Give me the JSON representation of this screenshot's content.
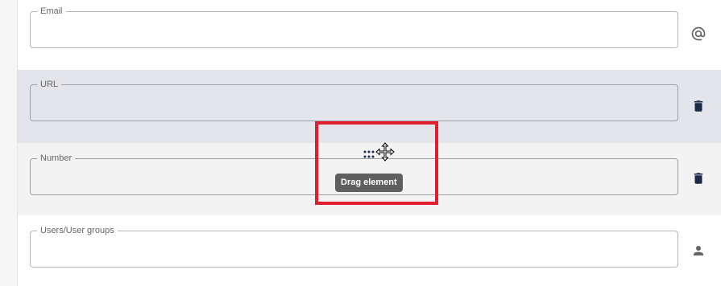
{
  "fields": {
    "email": {
      "label": "Email",
      "value": "",
      "icon": "at-icon"
    },
    "url": {
      "label": "URL",
      "value": "",
      "icon": "trash-icon"
    },
    "number": {
      "label": "Number",
      "value": "",
      "icon": "trash-icon"
    },
    "users": {
      "label": "Users/User groups",
      "value": "",
      "icon": "person-icon"
    }
  },
  "drag": {
    "tooltip": "Drag element",
    "handle_icon": "drag-handle-icon",
    "cursor_icon": "move-cursor-icon"
  },
  "colors": {
    "highlight": "#e01e2d",
    "trash": "#1b2a4a",
    "hover_row": "#e3e5ea",
    "tooltip_bg": "#5f5f5f"
  }
}
